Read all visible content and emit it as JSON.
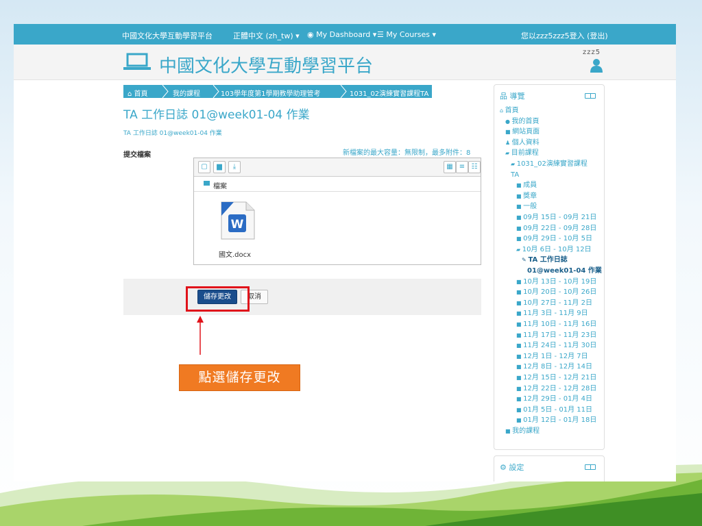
{
  "topbar": {
    "site_name": "中國文化大學互動學習平台",
    "language": "正體中文 (zh_tw)",
    "dashboard": "My Dashboard",
    "courses": "My Courses",
    "login_info": "您以zzz5zzz5登入 (登出)"
  },
  "header": {
    "title": "中國文化大學互動學習平台",
    "user": "zzz5"
  },
  "breadcrumb": [
    "首頁",
    "我的課程",
    "103學年度第1學期教學助理管考",
    "1031_02演練實習課程TA"
  ],
  "page": {
    "title": "TA 工作日誌 01@week01-04 作業",
    "subtitle": "TA 工作日誌 01@week01-04 作業",
    "submit_label": "提交檔案",
    "limits": "新檔案的最大容量：無限制，最多附件：8"
  },
  "filemanager": {
    "path_label": "檔案",
    "files": [
      {
        "name": "國文.docx",
        "icon": "word-doc-icon"
      }
    ]
  },
  "buttons": {
    "save": "儲存更改",
    "cancel": "取消"
  },
  "callout": "點選儲存更改",
  "colors": {
    "accent": "#3aa7c9",
    "highlight": "#e0121a",
    "callout": "#f07a22",
    "save_button": "#1a4d8c"
  },
  "navigation": {
    "title": "導覽",
    "items": [
      {
        "label": "首頁",
        "icon": "home-icon"
      },
      {
        "label": "我的首頁",
        "icon": "bullet-icon"
      },
      {
        "label": "網站頁面",
        "icon": "folder-icon"
      },
      {
        "label": "個人資料",
        "icon": "person-icon"
      },
      {
        "label": "目前課程",
        "icon": "folder-open-icon"
      },
      {
        "label": "1031_02演練實習課程",
        "icon": "folder-open-icon"
      },
      {
        "label": "TA",
        "icon": ""
      },
      {
        "label": "成員",
        "icon": "folder-icon"
      },
      {
        "label": "獎章",
        "icon": "folder-icon"
      },
      {
        "label": "一般",
        "icon": "folder-icon"
      },
      {
        "label": "09月 15日 - 09月 21日",
        "icon": "folder-icon"
      },
      {
        "label": "09月 22日 - 09月 28日",
        "icon": "folder-icon"
      },
      {
        "label": "09月 29日 - 10月 5日",
        "icon": "folder-icon"
      },
      {
        "label": "10月 6日 - 10月 12日",
        "icon": "folder-open-icon"
      },
      {
        "label": "TA 工作日誌",
        "icon": "assignment-icon"
      },
      {
        "label": "01@week01-04 作業",
        "icon": ""
      },
      {
        "label": "10月 13日 - 10月 19日",
        "icon": "folder-icon"
      },
      {
        "label": "10月 20日 - 10月 26日",
        "icon": "folder-icon"
      },
      {
        "label": "10月 27日 - 11月 2日",
        "icon": "folder-icon"
      },
      {
        "label": "11月 3日 - 11月 9日",
        "icon": "folder-icon"
      },
      {
        "label": "11月 10日 - 11月 16日",
        "icon": "folder-icon"
      },
      {
        "label": "11月 17日 - 11月 23日",
        "icon": "folder-icon"
      },
      {
        "label": "11月 24日 - 11月 30日",
        "icon": "folder-icon"
      },
      {
        "label": "12月 1日 - 12月 7日",
        "icon": "folder-icon"
      },
      {
        "label": "12月 8日 - 12月 14日",
        "icon": "folder-icon"
      },
      {
        "label": "12月 15日 - 12月 21日",
        "icon": "folder-icon"
      },
      {
        "label": "12月 22日 - 12月 28日",
        "icon": "folder-icon"
      },
      {
        "label": "12月 29日 - 01月 4日",
        "icon": "folder-icon"
      },
      {
        "label": "01月 5日 - 01月 11日",
        "icon": "folder-icon"
      },
      {
        "label": "01月 12日 - 01月 18日",
        "icon": "folder-icon"
      },
      {
        "label": "我的課程",
        "icon": "folder-icon"
      }
    ]
  },
  "settings": {
    "title": "設定"
  }
}
